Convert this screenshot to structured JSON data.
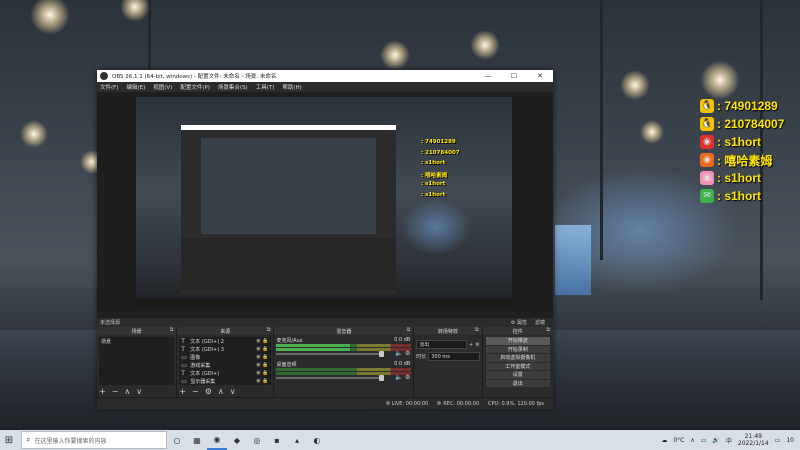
{
  "overlay": {
    "contacts": [
      {
        "icon": "qq-penguin-icon",
        "glyph": "🐧",
        "text": ": 74901289",
        "bg": "#f2c300"
      },
      {
        "icon": "qq-penguin-icon",
        "glyph": "🐧",
        "text": ": 210784007",
        "bg": "#f2c300"
      },
      {
        "icon": "weibo-icon",
        "glyph": "◉",
        "text": ": s1hort",
        "bg": "#e0302b"
      },
      {
        "icon": "weibo-icon",
        "glyph": "◉",
        "text": ": 嘻哈素姆",
        "bg": "#e86a1a"
      },
      {
        "icon": "bilibili-icon",
        "glyph": "▣",
        "text": ": s1hort",
        "bg": "#f391b4"
      },
      {
        "icon": "wechat-icon",
        "glyph": "✉",
        "text": ": s1hort",
        "bg": "#3bb34a"
      }
    ],
    "text_color": "#ffe600"
  },
  "inner_overlay": [
    ": 74901289",
    ": 210784007",
    ": s1hort",
    ": 嘻哈素姆",
    ": s1hort",
    ": s1hort"
  ],
  "window": {
    "title": "OBS 26.1.1 (64-bit, windows) - 配置文件: 未命名 - 场景: 未命名",
    "minimize": "—",
    "maximize": "☐",
    "close": "✕"
  },
  "menu": [
    "文件(F)",
    "编辑(E)",
    "视图(V)",
    "配置文件(P)",
    "场景集合(S)",
    "工具(T)",
    "帮助(H)"
  ],
  "source_bar": {
    "selection": "未选择源",
    "properties": "⚙ 属性",
    "filters": "滤镜"
  },
  "scenes": {
    "title": "场景",
    "items": [
      "场景"
    ]
  },
  "sources": {
    "title": "来源",
    "items": [
      {
        "icon": "T",
        "name": "文本 (GDI+) 2"
      },
      {
        "icon": "T",
        "name": "文本 (GDI+) 3"
      },
      {
        "icon": "▭",
        "name": "图像"
      },
      {
        "icon": "▭",
        "name": "游戏采集"
      },
      {
        "icon": "T",
        "name": "文本 (GDI+)"
      },
      {
        "icon": "▭",
        "name": "显示器采集"
      }
    ]
  },
  "mixer": {
    "title": "混音器",
    "tracks": [
      {
        "name": "麦克风/Aux",
        "db": "0.0 dB"
      },
      {
        "name": "桌面音频",
        "db": "0.0 dB"
      }
    ]
  },
  "transitions": {
    "title": "转场特效",
    "type": "淡出",
    "duration_label": "时长",
    "duration": "300 ms"
  },
  "controls": {
    "title": "控件",
    "buttons": [
      "开始推流",
      "开始录制",
      "启动虚拟摄像机",
      "工作室模式",
      "设置",
      "退出"
    ]
  },
  "status": {
    "live": "LIVE: 00:00:00",
    "rec": "REC: 00:00:00",
    "cpu": "CPU: 0.9%, 120.00 fps"
  },
  "taskbar": {
    "search_placeholder": "在这里输入你要搜索的内容",
    "weather": "0°C",
    "time": "21:49",
    "date": "2022/1/14",
    "lang": "中",
    "notify": "10"
  }
}
